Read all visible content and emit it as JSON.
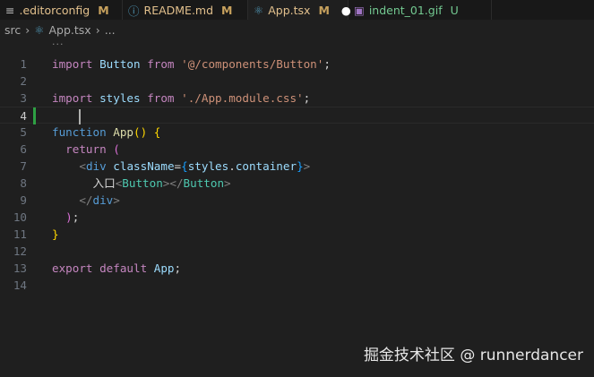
{
  "tabs": [
    {
      "label": ".editorconfig",
      "status": "M",
      "icon": "list-icon",
      "icon_color": "#bbbbbb"
    },
    {
      "label": "README.md",
      "status": "M",
      "icon": "info-icon",
      "icon_color": "#519aba"
    },
    {
      "label": "App.tsx",
      "status": "M",
      "icon": "react-icon",
      "icon_color": "#519aba",
      "active": true,
      "unsaved": true
    },
    {
      "label": "indent_01.gif",
      "status": "U",
      "icon": "image-icon",
      "icon_color": "#a074c4"
    }
  ],
  "breadcrumb": {
    "folder": "src",
    "file": "App.tsx",
    "more": "..."
  },
  "ellipsis": "...",
  "lines": [
    {
      "n": "1",
      "t": [
        [
          "kw",
          "import"
        ],
        [
          "txt",
          " "
        ],
        [
          "id",
          "Button"
        ],
        [
          "txt",
          " "
        ],
        [
          "kw",
          "from"
        ],
        [
          "txt",
          " "
        ],
        [
          "str",
          "'@/components/Button'"
        ],
        [
          "pun",
          ";"
        ]
      ]
    },
    {
      "n": "2",
      "t": []
    },
    {
      "n": "3",
      "t": [
        [
          "kw",
          "import"
        ],
        [
          "txt",
          " "
        ],
        [
          "id",
          "styles"
        ],
        [
          "txt",
          " "
        ],
        [
          "kw",
          "from"
        ],
        [
          "txt",
          " "
        ],
        [
          "str",
          "'./App.module.css'"
        ],
        [
          "pun",
          ";"
        ]
      ]
    },
    {
      "n": "4",
      "t": [
        [
          "txt",
          "    "
        ],
        [
          "caret",
          ""
        ]
      ],
      "current": true
    },
    {
      "n": "5",
      "t": [
        [
          "fn",
          "function"
        ],
        [
          "txt",
          " "
        ],
        [
          "fnname",
          "App"
        ],
        [
          "b1",
          "()"
        ],
        [
          "txt",
          " "
        ],
        [
          "b1",
          "{"
        ]
      ]
    },
    {
      "n": "6",
      "t": [
        [
          "txt",
          "  "
        ],
        [
          "kw",
          "return"
        ],
        [
          "txt",
          " "
        ],
        [
          "b2",
          "("
        ]
      ]
    },
    {
      "n": "7",
      "t": [
        [
          "txt",
          "    "
        ],
        [
          "tagp",
          "<"
        ],
        [
          "tag",
          "div"
        ],
        [
          "txt",
          " "
        ],
        [
          "id",
          "className"
        ],
        [
          "pun",
          "="
        ],
        [
          "b3",
          "{"
        ],
        [
          "id",
          "styles"
        ],
        [
          "pun",
          "."
        ],
        [
          "id",
          "container"
        ],
        [
          "b3",
          "}"
        ],
        [
          "tagp",
          ">"
        ]
      ]
    },
    {
      "n": "8",
      "t": [
        [
          "txt",
          "      入口"
        ],
        [
          "tagp",
          "<"
        ],
        [
          "comp",
          "Button"
        ],
        [
          "tagp",
          "></"
        ],
        [
          "comp",
          "Button"
        ],
        [
          "tagp",
          ">"
        ]
      ]
    },
    {
      "n": "9",
      "t": [
        [
          "txt",
          "    "
        ],
        [
          "tagp",
          "</"
        ],
        [
          "tag",
          "div"
        ],
        [
          "tagp",
          ">"
        ]
      ]
    },
    {
      "n": "10",
      "t": [
        [
          "txt",
          "  "
        ],
        [
          "b2",
          ")"
        ],
        [
          "pun",
          ";"
        ]
      ]
    },
    {
      "n": "11",
      "t": [
        [
          "b1",
          "}"
        ]
      ]
    },
    {
      "n": "12",
      "t": []
    },
    {
      "n": "13",
      "t": [
        [
          "kw",
          "export"
        ],
        [
          "txt",
          " "
        ],
        [
          "kw",
          "default"
        ],
        [
          "txt",
          " "
        ],
        [
          "id",
          "App"
        ],
        [
          "pun",
          ";"
        ]
      ]
    },
    {
      "n": "14",
      "t": []
    }
  ],
  "watermark": "掘金技术社区 @ runnerdancer"
}
